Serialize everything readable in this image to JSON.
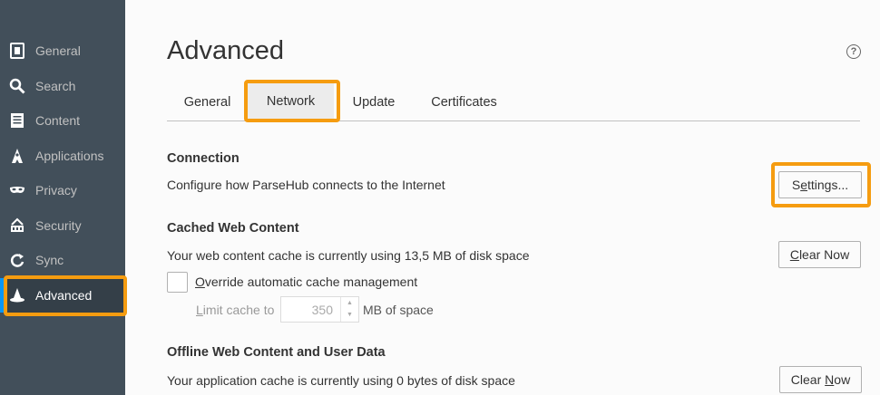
{
  "sidebar": {
    "items": [
      {
        "label": "General",
        "icon": "general-icon"
      },
      {
        "label": "Search",
        "icon": "search-icon"
      },
      {
        "label": "Content",
        "icon": "content-icon"
      },
      {
        "label": "Applications",
        "icon": "applications-icon"
      },
      {
        "label": "Privacy",
        "icon": "privacy-mask-icon"
      },
      {
        "label": "Security",
        "icon": "security-icon"
      },
      {
        "label": "Sync",
        "icon": "sync-icon"
      },
      {
        "label": "Advanced",
        "icon": "advanced-wizard-hat-icon"
      }
    ],
    "active": "Advanced"
  },
  "page": {
    "title": "Advanced",
    "help": "?"
  },
  "tabs": [
    {
      "label": "General"
    },
    {
      "label": "Network"
    },
    {
      "label": "Update"
    },
    {
      "label": "Certificates"
    }
  ],
  "connection": {
    "heading": "Connection",
    "description": "Configure how ParseHub connects to the Internet",
    "settings_prefix": "S",
    "settings_underlined": "e",
    "settings_rest": "ttings..."
  },
  "cache": {
    "heading": "Cached Web Content",
    "description": "Your web content cache is currently using 13,5 MB of disk space",
    "clear_underlined": "C",
    "clear_rest": "lear Now",
    "override_underlined": "O",
    "override_rest": "verride automatic cache management",
    "limit_underlined": "L",
    "limit_rest": "imit cache to",
    "limit_value": "350",
    "limit_unit": "MB of space"
  },
  "offline": {
    "heading": "Offline Web Content and User Data",
    "description": "Your application cache is currently using 0 bytes of disk space",
    "clear_prefix": "Clear ",
    "clear_underlined": "N",
    "clear_rest": "ow"
  },
  "colors": {
    "sidebar_bg": "#424f5a",
    "sidebar_active_bg": "#343f48",
    "accent": "#0996f8",
    "highlight": "#f59c10"
  }
}
